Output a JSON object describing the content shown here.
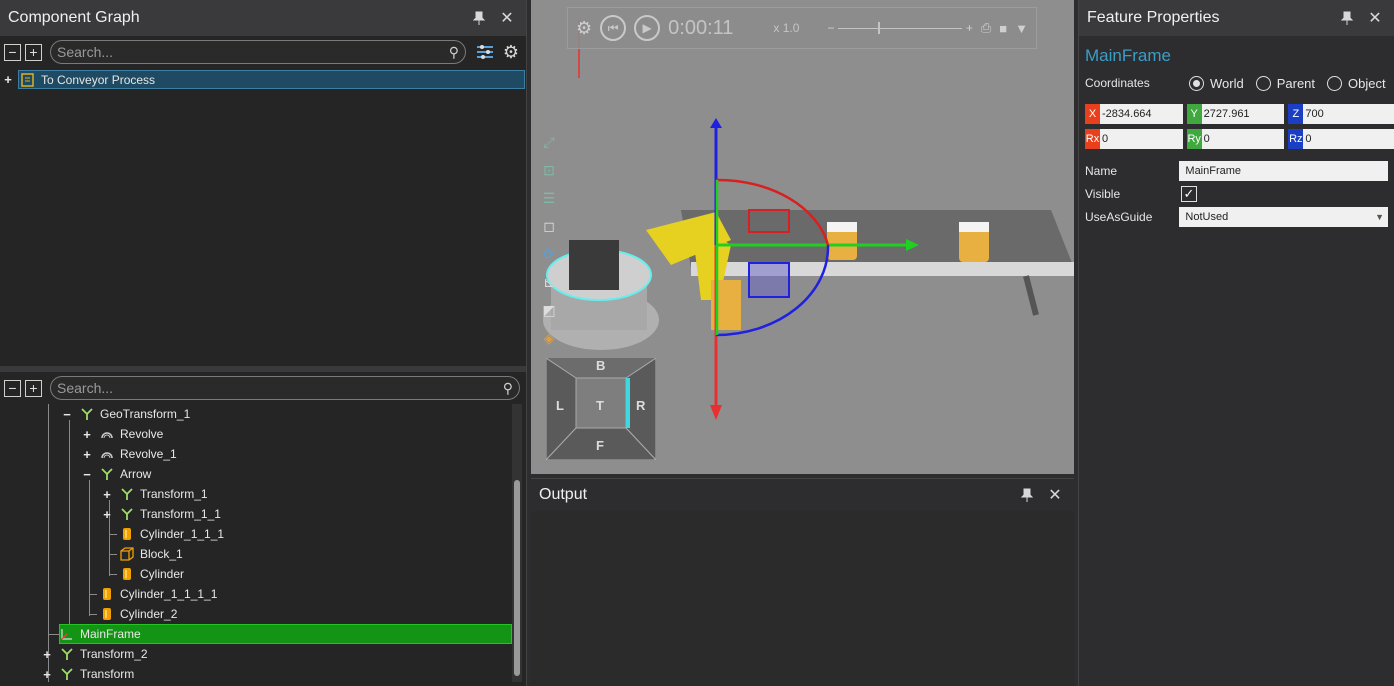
{
  "component_graph": {
    "title": "Component Graph",
    "pin_icon": "pin-icon",
    "close_icon": "close-icon",
    "search_placeholder": "Search...",
    "root_item": "To Conveyor Process"
  },
  "feature_tree": {
    "search_placeholder": "Search...",
    "nodes": [
      {
        "label": "GeoTransform_1",
        "icon": "transform-icon",
        "expander": "−"
      },
      {
        "label": "Revolve",
        "icon": "revolve-icon",
        "expander": "+"
      },
      {
        "label": "Revolve_1",
        "icon": "revolve-icon",
        "expander": "+"
      },
      {
        "label": "Arrow",
        "icon": "transform-icon",
        "expander": "−"
      },
      {
        "label": "Transform_1",
        "icon": "transform-icon",
        "expander": "+"
      },
      {
        "label": "Transform_1_1",
        "icon": "transform-icon",
        "expander": "+"
      },
      {
        "label": "Cylinder_1_1_1",
        "icon": "cylinder-icon",
        "expander": ""
      },
      {
        "label": "Block_1",
        "icon": "block-icon",
        "expander": ""
      },
      {
        "label": "Cylinder",
        "icon": "cylinder-icon",
        "expander": ""
      },
      {
        "label": "Cylinder_1_1_1_1",
        "icon": "cylinder-icon",
        "expander": ""
      },
      {
        "label": "Cylinder_2",
        "icon": "cylinder-icon",
        "expander": ""
      },
      {
        "label": "MainFrame",
        "icon": "frame-icon",
        "expander": "",
        "selected": true
      },
      {
        "label": "Transform_2",
        "icon": "transform-icon",
        "expander": "+"
      },
      {
        "label": "Transform",
        "icon": "transform-icon",
        "expander": "+"
      }
    ]
  },
  "viewport": {
    "time": "0:00:11",
    "speed": "x 1.0",
    "nav_cube": {
      "top": "B",
      "left": "L",
      "center": "T",
      "right": "R",
      "bottom": "F"
    }
  },
  "output": {
    "title": "Output"
  },
  "feature_properties": {
    "title": "Feature Properties",
    "feature_name": "MainFrame",
    "coordinates_label": "Coordinates",
    "coord_options": [
      "World",
      "Parent",
      "Object"
    ],
    "selected_coord": "World",
    "x": "-2834.664",
    "y": "2727.961",
    "z": "700",
    "rx": "0",
    "ry": "0",
    "rz": "0",
    "labels": {
      "x": "X",
      "y": "Y",
      "z": "Z",
      "rx": "Rx",
      "ry": "Ry",
      "rz": "Rz"
    },
    "name_label": "Name",
    "name_value": "MainFrame",
    "visible_label": "Visible",
    "visible": true,
    "guide_label": "UseAsGuide",
    "guide_value": "NotUsed"
  },
  "colors": {
    "accent_blue": "#3b9ec6",
    "selection_green": "#149414",
    "x_red": "#e8401c",
    "y_green": "#3fa83f",
    "z_blue": "#1a3fc4"
  }
}
